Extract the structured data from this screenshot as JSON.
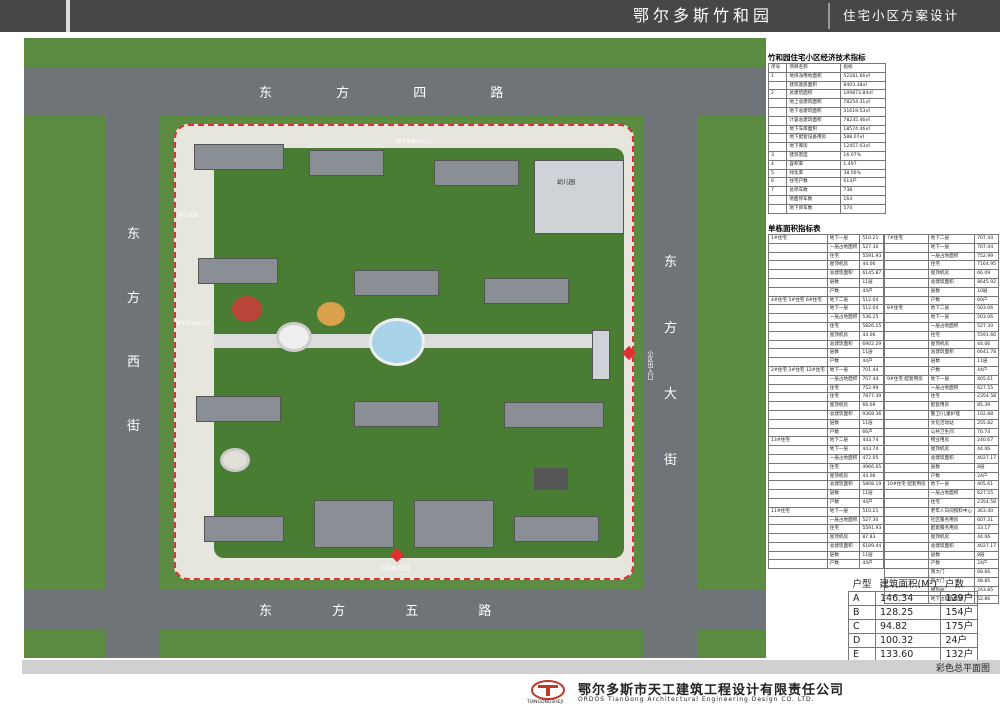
{
  "header": {
    "title": "鄂尔多斯竹和园",
    "subtitle": "住宅小区方案设计"
  },
  "plan": {
    "roads": {
      "north": "东 方 四 路",
      "south": "东 方 五 路",
      "west": "东 方 西 街",
      "east": "东 方 大 街"
    },
    "entrances": [
      "地下车库出入口",
      "地下车库出入口",
      "小区出入口",
      "小区出入口",
      "小区出入口"
    ],
    "labels": {
      "kindergarten": "幼儿园",
      "bike": "自行车库"
    }
  },
  "econ_table": {
    "title": "竹和园住宅小区经济技术指标",
    "headers": [
      "序号",
      "项目名称",
      "指标"
    ],
    "rows": [
      [
        "1",
        "地块净用地面积",
        "52281.66㎡"
      ],
      [
        "",
        "建筑基底面积",
        "8403.38㎡"
      ],
      [
        "2",
        "总建筑面积",
        "109873.84㎡"
      ],
      [
        "",
        "地上总建筑面积",
        "78254.31㎡"
      ],
      [
        "",
        "地下总建筑面积",
        "31619.53㎡"
      ],
      [
        "",
        "计容总建筑面积",
        "78235.46㎡"
      ],
      [
        "",
        "地下车库面积",
        "18574.46㎡"
      ],
      [
        "",
        "地下配套设备用房",
        "588.07㎡"
      ],
      [
        "",
        "地下库房",
        "12457.03㎡"
      ],
      [
        "3",
        "建筑密度",
        "16.07%"
      ],
      [
        "4",
        "容积率",
        "1.497"
      ],
      [
        "5",
        "绿化率",
        "38.56%"
      ],
      [
        "6",
        "住宅户数",
        "614户"
      ],
      [
        "7",
        "总停车数",
        "738"
      ],
      [
        "",
        "地面停车数",
        "164"
      ],
      [
        "",
        "地下停车数",
        "574"
      ]
    ]
  },
  "unit_table": {
    "title": "单栋面积指标表",
    "headers": [
      "名称",
      "面积(㎡)"
    ],
    "left": [
      [
        "1#住宅",
        "地下一层",
        "510.21"
      ],
      [
        "",
        "一层占地面积",
        "527.30"
      ],
      [
        "",
        "住宅",
        "5591.93"
      ],
      [
        "",
        "屋顶机房",
        "44.06"
      ],
      [
        "",
        "总建筑面积",
        "6145.87"
      ],
      [
        "",
        "层数",
        "11层"
      ],
      [
        "",
        "户数",
        "44户"
      ],
      [
        "4#住宅 5#住宅 6#住宅",
        "地下二层",
        "512.04"
      ],
      [
        "",
        "地下一层",
        "512.04"
      ],
      [
        "",
        "一层占地面积",
        "536.25"
      ],
      [
        "",
        "住宅",
        "5826.15"
      ],
      [
        "",
        "屋顶机房",
        "44.06"
      ],
      [
        "",
        "总建筑面积",
        "6902.29"
      ],
      [
        "",
        "层数",
        "11层"
      ],
      [
        "",
        "户数",
        "44户"
      ],
      [
        "2#住宅 3#住宅 12#住宅",
        "地下一层",
        "701.44"
      ],
      [
        "",
        "一层占地面积",
        "707.44"
      ],
      [
        "",
        "住宅",
        "752.99"
      ],
      [
        "",
        "住宅",
        "7877.39"
      ],
      [
        "",
        "屋顶机房",
        "66.09"
      ],
      [
        "",
        "总建筑面积",
        "9368.36"
      ],
      [
        "",
        "层数",
        "11层"
      ],
      [
        "",
        "户数",
        "66户"
      ],
      [
        "13#住宅",
        "地下二层",
        "443.74"
      ],
      [
        "",
        "地下一层",
        "443.74"
      ],
      [
        "",
        "一层占地面积",
        "472.05"
      ],
      [
        "",
        "住宅",
        "4966.65"
      ],
      [
        "",
        "屋顶机房",
        "44.06"
      ],
      [
        "",
        "总建筑面积",
        "5808.19"
      ],
      [
        "",
        "层数",
        "11层"
      ],
      [
        "",
        "户数",
        "44户"
      ],
      [
        "11#住宅",
        "地下一层",
        "510.21"
      ],
      [
        "",
        "一层占地面积",
        "527.30"
      ],
      [
        "",
        "住宅",
        "5591.93"
      ],
      [
        "",
        "屋顶机房",
        "87.83"
      ],
      [
        "",
        "总建筑面积",
        "6189.44"
      ],
      [
        "",
        "层数",
        "11层"
      ],
      [
        "",
        "户数",
        "44户"
      ]
    ],
    "right": [
      [
        "7#住宅",
        "地下二层",
        "707.44"
      ],
      [
        "",
        "地下一层",
        "707.44"
      ],
      [
        "",
        "一层占地面积",
        "752.99"
      ],
      [
        "",
        "住宅",
        "7164.95"
      ],
      [
        "",
        "屋顶机房",
        "66.09"
      ],
      [
        "",
        "总建筑面积",
        "8645.92"
      ],
      [
        "",
        "层数",
        "10层"
      ],
      [
        "",
        "户数",
        "60户"
      ],
      [
        "8#住宅",
        "地下二层",
        "503.06"
      ],
      [
        "",
        "地下一层",
        "503.06"
      ],
      [
        "",
        "一层占地面积",
        "527.30"
      ],
      [
        "",
        "住宅",
        "5591.60"
      ],
      [
        "",
        "屋顶机房",
        "44.06"
      ],
      [
        "",
        "总建筑面积",
        "6641.78"
      ],
      [
        "",
        "层数",
        "11层"
      ],
      [
        "",
        "户数",
        "44户"
      ],
      [
        "9#住宅 配套用房",
        "地下一层",
        "405.61"
      ],
      [
        "",
        "一层占地面积",
        "627.55"
      ],
      [
        "",
        "住宅",
        "2354.58"
      ],
      [
        "",
        "配套用房",
        "85.39"
      ],
      [
        "",
        "警卫/儿童护理",
        "102.88"
      ],
      [
        "",
        "文化活动站",
        "255.82"
      ],
      [
        "",
        "公共卫生间",
        "70.74"
      ],
      [
        "",
        "物业用房",
        "240.67"
      ],
      [
        "",
        "屋顶机房",
        "44.06"
      ],
      [
        "",
        "总建筑面积",
        "4027.17"
      ],
      [
        "",
        "层数",
        "8层"
      ],
      [
        "",
        "户数",
        "24户"
      ],
      [
        "10#住宅 配套用房",
        "地下一层",
        "405.61"
      ],
      [
        "",
        "一层占地面积",
        "627.55"
      ],
      [
        "",
        "住宅",
        "2354.58"
      ],
      [
        "",
        "老年人日间照料中心",
        "363.40"
      ],
      [
        "",
        "社区服务用房",
        "607.31"
      ],
      [
        "",
        "配套服务用房",
        "33.17"
      ],
      [
        "",
        "屋顶机房",
        "44.06"
      ],
      [
        "",
        "总建筑面积",
        "4027.17"
      ],
      [
        "",
        "层数",
        "8层"
      ],
      [
        "",
        "户数",
        "24户"
      ],
      [
        "",
        "南大门",
        "68.66"
      ],
      [
        "",
        "东大门",
        "48.85"
      ],
      [
        "",
        "换热站",
        "243.85"
      ],
      [
        "",
        "地下垃圾收集站",
        "52.86"
      ]
    ]
  },
  "unit_types": {
    "headers": [
      "户型",
      "建筑面积(M²)",
      "户数"
    ],
    "rows": [
      [
        "A",
        "146.34",
        "129户"
      ],
      [
        "B",
        "128.25",
        "154户"
      ],
      [
        "C",
        "94.82",
        "175户"
      ],
      [
        "D",
        "100.32",
        "24户"
      ],
      [
        "E",
        "133.60",
        "132户"
      ]
    ]
  },
  "footer": {
    "caption": "彩色总平面图",
    "company": "鄂尔多斯市天工建筑工程设计有限责任公司",
    "company_en": "ORDOS TianGong Architectural Engineering Design CO. LTD.",
    "logo_text": "TIANGONGSHEJI"
  }
}
